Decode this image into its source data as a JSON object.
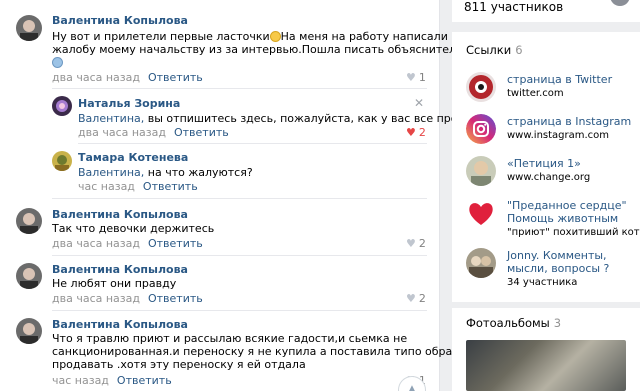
{
  "comments": [
    {
      "author": "Валентина Копылова",
      "text_lines": [
        "Ну вот и прилетели первые ласточки",
        "На меня на работу написали",
        "жалобу моему начальству из за интервью.Пошла писать объяснительные"
      ],
      "time": "два часа назад",
      "reply": "Ответить",
      "likes": "1"
    },
    {
      "author": "Наталья Зорина",
      "addressee": "Валентина,",
      "text": " вы отпишитесь здесь, пожалуйста, как у вас все прошло",
      "time": "два часа назад",
      "reply": "Ответить",
      "likes": "2"
    },
    {
      "author": "Тамара Котенева",
      "addressee": "Валентина,",
      "text": " на что жалуются?",
      "time": "час назад",
      "reply": "Ответить"
    },
    {
      "author": "Валентина Копылова",
      "text": "Так что девочки держитесь",
      "time": "два часа назад",
      "reply": "Ответить",
      "likes": "2"
    },
    {
      "author": "Валентина Копылова",
      "text": "Не любят они правду",
      "time": "два часа назад",
      "reply": "Ответить",
      "likes": "2"
    },
    {
      "author": "Валентина Копылова",
      "text_lines": [
        "Что я травлю приют и рассылаю всякие гадости,и сьемка не",
        "санкционированная.и переноску я не купила а поставила типо обратно",
        "продавать .хотя эту переноску я ей отдала"
      ],
      "time": "час назад",
      "reply": "Ответить",
      "likes": "1"
    }
  ],
  "sidebar": {
    "members_text": "811 участников",
    "links_title": "Ссылки",
    "links_count": "6",
    "links": [
      {
        "title": "страница в Twitter",
        "sub": "twitter.com",
        "icon": "twitter-logo-icon"
      },
      {
        "title": "страница в Instagram",
        "sub": "www.instagram.com",
        "icon": "instagram-logo-icon"
      },
      {
        "title": "«Петиция 1»",
        "sub": "www.change.org",
        "icon": "petition-photo-icon"
      },
      {
        "title": "\"Преданное сердце\"",
        "title2": "Помощь животным",
        "sub": "\"приют\" похитивший кота",
        "icon": "heart-icon"
      },
      {
        "title": "Jonny. Комменты,",
        "title2": "мысли, вопросы ?",
        "sub": "34 участника",
        "icon": "group-photo-icon"
      }
    ],
    "albums_title": "Фотоальбомы",
    "albums_count": "3"
  },
  "colors": {
    "link": "#2a5885",
    "meta": "#939393",
    "liked": "#e64646",
    "background": "#edeef0",
    "panel": "#ffffff"
  }
}
